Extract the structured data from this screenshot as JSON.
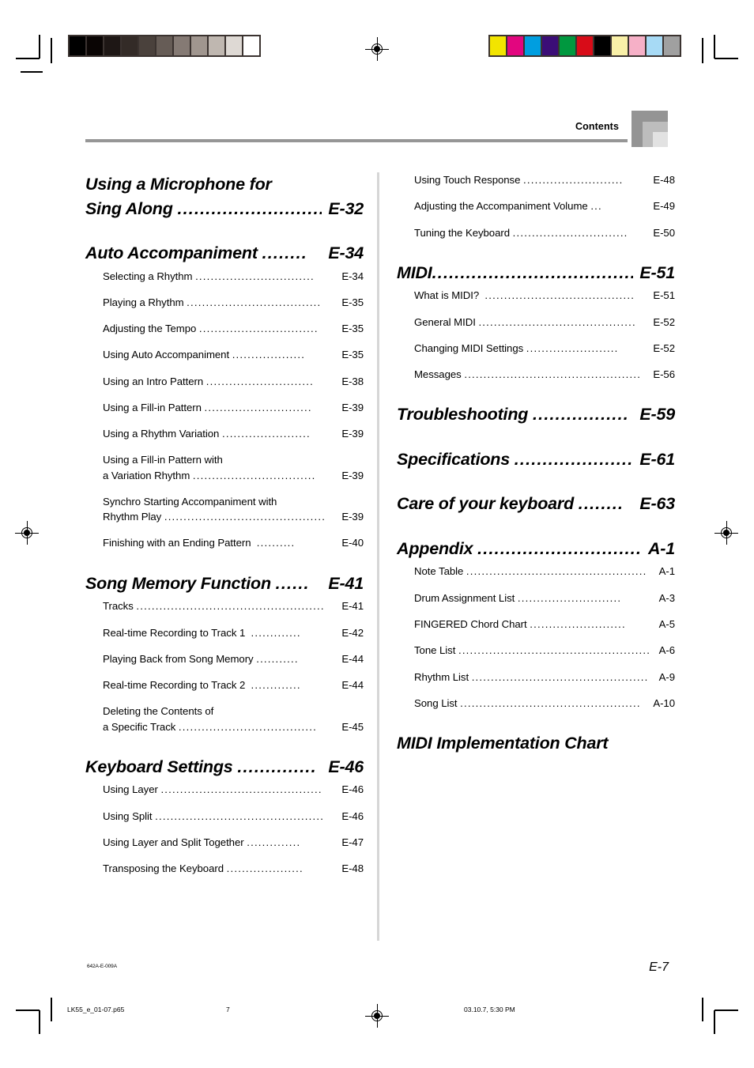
{
  "header": {
    "label": "Contents"
  },
  "footer": {
    "code": "642A-E-009A",
    "page": "E-7"
  },
  "print_strip": {
    "filename": "LK55_e_01-07.p65",
    "page_number": "7",
    "timestamp": "03.10.7, 5:30 PM"
  },
  "colors": {
    "header_rule": "#969696",
    "divider": "#d6d6d6",
    "motif_dark": "#949494",
    "motif_mid": "#bdbdbd",
    "motif_light": "#e2e2e2",
    "swatch_frame": "#3b3330"
  },
  "grayscale_swatches": [
    "#000000",
    "#0a0504",
    "#1e1715",
    "#332b27",
    "#4a413c",
    "#665c56",
    "#857a74",
    "#a0968f",
    "#bfb7b0",
    "#ded9d4",
    "#ffffff"
  ],
  "color_swatches": [
    "#f2e400",
    "#e2067f",
    "#009ee0",
    "#3b0d77",
    "#00983f",
    "#d80c18",
    "#000000",
    "#f9f0a8",
    "#f6b0c7",
    "#a7daf5",
    "#a0a0a0"
  ],
  "left_column": [
    {
      "type": "section",
      "lines": [
        "Using a Microphone for"
      ],
      "title": "Sing Along ",
      "leader": "...........................",
      "page": " E-32"
    },
    {
      "type": "section",
      "title": "Auto Accompaniment ",
      "leader": "........",
      "page": " E-34"
    },
    {
      "type": "entry",
      "title": "Selecting a Rhythm ",
      "leader": "...............................",
      "page": " E-34"
    },
    {
      "type": "entry",
      "title": "Playing a Rhythm ",
      "leader": "...................................",
      "page": " E-35"
    },
    {
      "type": "entry",
      "title": "Adjusting the Tempo ",
      "leader": "...............................",
      "page": " E-35"
    },
    {
      "type": "entry",
      "title": "Using Auto Accompaniment ",
      "leader": "...................",
      "page": " E-35"
    },
    {
      "type": "entry",
      "title": "Using an Intro Pattern ",
      "leader": "............................",
      "page": " E-38"
    },
    {
      "type": "entry",
      "title": "Using a Fill-in Pattern ",
      "leader": "............................",
      "page": " E-39"
    },
    {
      "type": "entry",
      "title": "Using a Rhythm Variation ",
      "leader": ".......................",
      "page": " E-39"
    },
    {
      "type": "entry",
      "lines": [
        "Using a Fill-in Pattern with"
      ],
      "title": "a Variation Rhythm ",
      "leader": "................................",
      "page": " E-39"
    },
    {
      "type": "entry",
      "lines": [
        "Synchro Starting Accompaniment with"
      ],
      "title": "Rhythm Play ",
      "leader": "..........................................",
      "page": " E-39"
    },
    {
      "type": "entry",
      "title": "Finishing with an Ending Pattern  ",
      "leader": "..........",
      "page": " E-40"
    },
    {
      "type": "section",
      "title": "Song Memory Function ",
      "leader": "......",
      "page": " E-41"
    },
    {
      "type": "entry",
      "title": "Tracks ",
      "leader": ".................................................",
      "page": " E-41"
    },
    {
      "type": "entry",
      "title": "Real-time Recording to Track 1  ",
      "leader": ".............",
      "page": " E-42"
    },
    {
      "type": "entry",
      "title": "Playing Back from Song Memory ",
      "leader": "...........",
      "page": " E-44"
    },
    {
      "type": "entry",
      "title": "Real-time Recording to Track 2  ",
      "leader": ".............",
      "page": " E-44"
    },
    {
      "type": "entry",
      "lines": [
        "Deleting the Contents of"
      ],
      "title": "a Specific Track ",
      "leader": "....................................",
      "page": " E-45"
    },
    {
      "type": "section",
      "title": "Keyboard Settings ",
      "leader": "..............",
      "page": " E-46"
    },
    {
      "type": "entry",
      "title": "Using Layer ",
      "leader": "..........................................",
      "page": " E-46"
    },
    {
      "type": "entry",
      "title": "Using Split ",
      "leader": "............................................",
      "page": " E-46"
    },
    {
      "type": "entry",
      "title": "Using Layer and Split Together ",
      "leader": "..............",
      "page": " E-47"
    },
    {
      "type": "entry",
      "title": "Transposing the Keyboard ",
      "leader": "....................",
      "page": " E-48"
    }
  ],
  "right_column": [
    {
      "type": "entry",
      "title": "Using Touch Response ",
      "leader": "..........................",
      "page": " E-48"
    },
    {
      "type": "entry",
      "title": "Adjusting the Accompaniment Volume ",
      "leader": "...",
      "page": " E-49"
    },
    {
      "type": "entry",
      "title": "Tuning the Keyboard ",
      "leader": "..............................",
      "page": " E-50"
    },
    {
      "type": "section",
      "title": "MIDI",
      "leader": "........................................",
      "page": " E-51"
    },
    {
      "type": "entry",
      "title": "What is MIDI?  ",
      "leader": ".......................................",
      "page": " E-51"
    },
    {
      "type": "entry",
      "title": "General MIDI ",
      "leader": ".........................................",
      "page": " E-52"
    },
    {
      "type": "entry",
      "title": "Changing MIDI Settings ",
      "leader": "........................",
      "page": " E-52"
    },
    {
      "type": "entry",
      "title": "Messages ",
      "leader": "..............................................",
      "page": " E-56"
    },
    {
      "type": "section",
      "title": "Troubleshooting ",
      "leader": ".................",
      "page": " E-59"
    },
    {
      "type": "section",
      "title": "Specifications ",
      "leader": ".....................",
      "page": " E-61"
    },
    {
      "type": "section",
      "title": "Care of your keyboard ",
      "leader": "........",
      "page": " E-63"
    },
    {
      "type": "section",
      "title": "Appendix ",
      "leader": "...............................",
      "page": " A-1"
    },
    {
      "type": "entry",
      "title": "Note Table ",
      "leader": "...............................................",
      "page": " A-1"
    },
    {
      "type": "entry",
      "title": "Drum Assignment List ",
      "leader": "...........................",
      "page": " A-3"
    },
    {
      "type": "entry",
      "title": "FINGERED Chord Chart ",
      "leader": ".........................",
      "page": " A-5"
    },
    {
      "type": "entry",
      "title": "Tone List ",
      "leader": "..................................................",
      "page": " A-6"
    },
    {
      "type": "entry",
      "title": "Rhythm List ",
      "leader": "..............................................",
      "page": " A-9"
    },
    {
      "type": "entry",
      "title": "Song List ",
      "leader": "...............................................",
      "page": " A-10"
    },
    {
      "type": "section",
      "title": "MIDI Implementation Chart",
      "leader": "",
      "page": ""
    }
  ]
}
